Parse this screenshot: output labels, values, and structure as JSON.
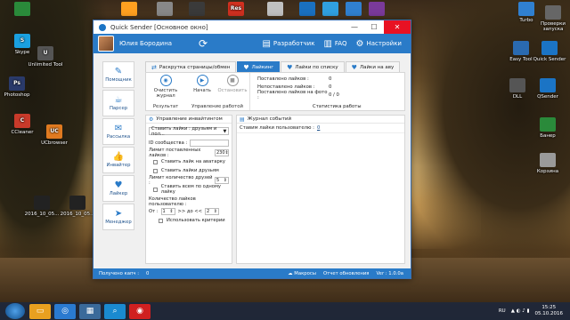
{
  "desktop": {
    "icons_left": [
      {
        "label": "",
        "color": "#2a8a3a"
      },
      {
        "label": "Skype",
        "color": "#1aa0e0"
      },
      {
        "label": "Unlimited Tool",
        "color": "#555555"
      },
      {
        "label": "Photoshop",
        "color": "#2a3a6a"
      },
      {
        "label": "CCleaner",
        "color": "#c83a2a"
      },
      {
        "label": "UCbrowser",
        "color": "#e07a20"
      }
    ],
    "icons_top": [
      {
        "label": "",
        "color": "#ffa020"
      },
      {
        "label": "",
        "color": "#888888"
      },
      {
        "label": "",
        "color": "#3a3a3a"
      },
      {
        "label": "",
        "color": "#d03020"
      },
      {
        "label": "",
        "color": "#c0c0c0"
      },
      {
        "label": "",
        "color": "#1a70c0"
      },
      {
        "label": "",
        "color": "#30a0e0"
      },
      {
        "label": "",
        "color": "#3080d0"
      },
      {
        "label": "",
        "color": "#7a3a9a"
      }
    ],
    "icons_right": [
      {
        "label": "Turbo",
        "color": "#3080d0"
      },
      {
        "label": "Проверки запуска",
        "color": "#666666"
      },
      {
        "label": "Easy Tool",
        "color": "#2a6ab0"
      },
      {
        "label": "Quick Sender",
        "color": "#1b74c5"
      },
      {
        "label": "DLL",
        "color": "#555555"
      },
      {
        "label": "QSender",
        "color": "#1b74c5"
      },
      {
        "label": "Банер",
        "color": "#2a8a3a"
      },
      {
        "label": "Корзина",
        "color": "#9a9a9a"
      }
    ],
    "icons_mid": [
      {
        "label": "2016_10_05...",
        "color": "#222222"
      },
      {
        "label": "2016_10_05...",
        "color": "#222222"
      }
    ]
  },
  "window": {
    "title": "Quick Sender [Основное окно]",
    "min": "—",
    "max": "☐",
    "close": "✕"
  },
  "header": {
    "username": "Юлия Бородина",
    "sync_icon": "⟳",
    "developer": "Разработчик",
    "faq": "FAQ",
    "settings": "Настройки"
  },
  "sidebar": [
    {
      "label": "Помощник",
      "icon": "✎"
    },
    {
      "label": "Парсер",
      "icon": "☕"
    },
    {
      "label": "Рассылка",
      "icon": "✉"
    },
    {
      "label": "Инвайтер",
      "icon": "👍"
    },
    {
      "label": "Лайкер",
      "icon": "♥"
    },
    {
      "label": "Менеджер",
      "icon": "➤"
    }
  ],
  "tabs": [
    {
      "label": "Раскрутка страницы/обмен",
      "icon": "⇄",
      "active": false
    },
    {
      "label": "Лайкинг",
      "icon": "♥",
      "active": true
    },
    {
      "label": "Лайки по списку",
      "icon": "♥",
      "active": false
    },
    {
      "label": "Лайки на аву",
      "icon": "♥",
      "active": false
    }
  ],
  "ribbon": {
    "result": {
      "group": "Результат",
      "clear": "Очистить журнал"
    },
    "control": {
      "group": "Управление работой",
      "start": "Начать",
      "stop": "Остановить"
    },
    "stats": {
      "group": "Статистика работы",
      "rows": [
        {
          "k": "Поставлено лайков :",
          "v": "0"
        },
        {
          "k": "Непоставлено лайков :",
          "v": "0"
        },
        {
          "k": "Поставлено лайков на фото :",
          "v": "0 / 0"
        }
      ]
    }
  },
  "left_panel": {
    "title": "Управление инвайтингом",
    "mode": "Ставить лайки : друзьям и пол...",
    "community_id_label": "ID сообщества :",
    "limit_label": "Лимит поставленных лайков :",
    "limit_value": "230",
    "cb_avatar": "Ставить лайк на аватарку",
    "cb_friends": "Ставить лайки друзьям",
    "friends_limit_label": "Лимит количество друзей :",
    "friends_limit_value": "5",
    "cb_all_one": "Ставить всем по одному лайку",
    "user_likes_label": "Количество лайков пользователю :",
    "from_label": "От :",
    "from_value": "1",
    "to_label": ">> до <<",
    "to_value": "2",
    "cb_criteria": "Использовать критерии"
  },
  "right_panel": {
    "title": "Журнал событий",
    "line_label": "Ставим лайки пользователю :",
    "line_count": "0"
  },
  "statusbar": {
    "left": "Получено капч :",
    "left_value": "0",
    "macros": "Макросы",
    "report": "Отчет обновления",
    "version": "Ver : 1.0.0a"
  },
  "taskbar": {
    "lang": "RU",
    "time": "15:25",
    "date": "05.10.2016"
  }
}
